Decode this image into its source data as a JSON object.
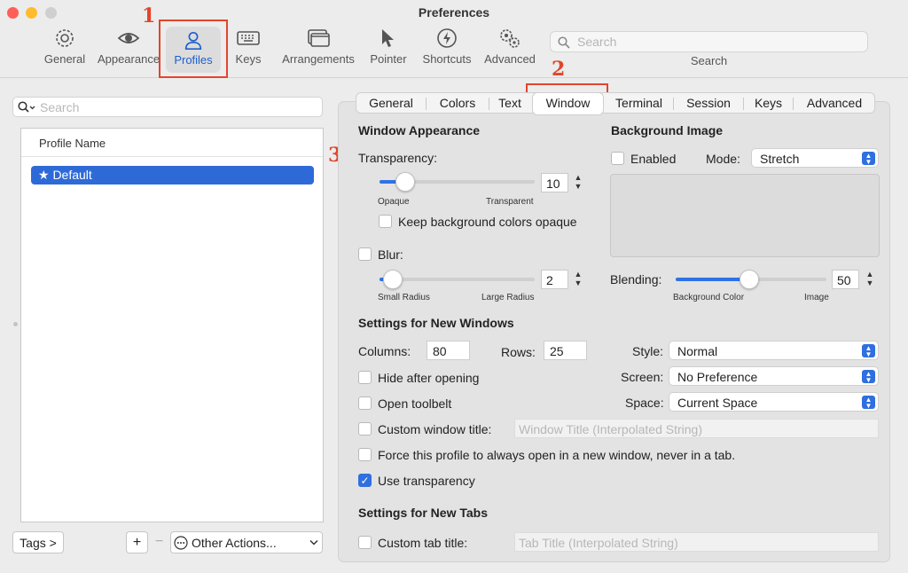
{
  "window": {
    "title": "Preferences"
  },
  "colors": {
    "accent": "#2f6fdf",
    "selected_tool": "#1d5fcf",
    "annotation": "#e2452b"
  },
  "toolbar": {
    "items": [
      {
        "label": "General",
        "icon": "gear-icon"
      },
      {
        "label": "Appearance",
        "icon": "eye-icon"
      },
      {
        "label": "Profiles",
        "icon": "person-icon",
        "selected": true
      },
      {
        "label": "Keys",
        "icon": "keyboard-icon"
      },
      {
        "label": "Arrangements",
        "icon": "windows-icon"
      },
      {
        "label": "Pointer",
        "icon": "pointer-icon"
      },
      {
        "label": "Shortcuts",
        "icon": "lightning-icon"
      },
      {
        "label": "Advanced",
        "icon": "gears-icon"
      }
    ],
    "search_placeholder": "Search",
    "search_label": "Search"
  },
  "annotations": {
    "n1": "1",
    "n2": "2",
    "n3": "3"
  },
  "sidebar": {
    "search_placeholder": "Search",
    "list_header": "Profile Name",
    "profiles": [
      {
        "name": "★ Default",
        "selected": true
      }
    ],
    "tags_button": "Tags >",
    "add_button": "+",
    "remove_button": "−",
    "other_actions": "Other Actions..."
  },
  "tabs": [
    "General",
    "Colors",
    "Text",
    "Window",
    "Terminal",
    "Session",
    "Keys",
    "Advanced"
  ],
  "selected_tab": "Window",
  "window_appearance": {
    "heading": "Window Appearance",
    "transparency_label": "Transparency:",
    "transparency_value": "10",
    "transparency_min_label": "Opaque",
    "transparency_max_label": "Transparent",
    "keep_bg_opaque": "Keep background colors opaque",
    "blur_label": "Blur:",
    "blur_value": "2",
    "blur_min_label": "Small Radius",
    "blur_max_label": "Large Radius"
  },
  "background_image": {
    "heading": "Background Image",
    "enabled_label": "Enabled",
    "mode_label": "Mode:",
    "mode_value": "Stretch",
    "blending_label": "Blending:",
    "blending_value": "50",
    "blending_min_label": "Background Color",
    "blending_max_label": "Image"
  },
  "new_windows": {
    "heading": "Settings for New Windows",
    "columns_label": "Columns:",
    "columns_value": "80",
    "rows_label": "Rows:",
    "rows_value": "25",
    "style_label": "Style:",
    "style_value": "Normal",
    "screen_label": "Screen:",
    "screen_value": "No Preference",
    "space_label": "Space:",
    "space_value": "Current Space",
    "hide_after_opening": "Hide after opening",
    "open_toolbelt": "Open toolbelt",
    "custom_window_title": "Custom window title:",
    "window_title_placeholder": "Window Title (Interpolated String)",
    "force_new_window": "Force this profile to always open in a new window, never in a tab.",
    "use_transparency": "Use transparency"
  },
  "new_tabs": {
    "heading": "Settings for New Tabs",
    "custom_tab_title": "Custom tab title:",
    "tab_title_placeholder": "Tab Title (Interpolated String)"
  }
}
